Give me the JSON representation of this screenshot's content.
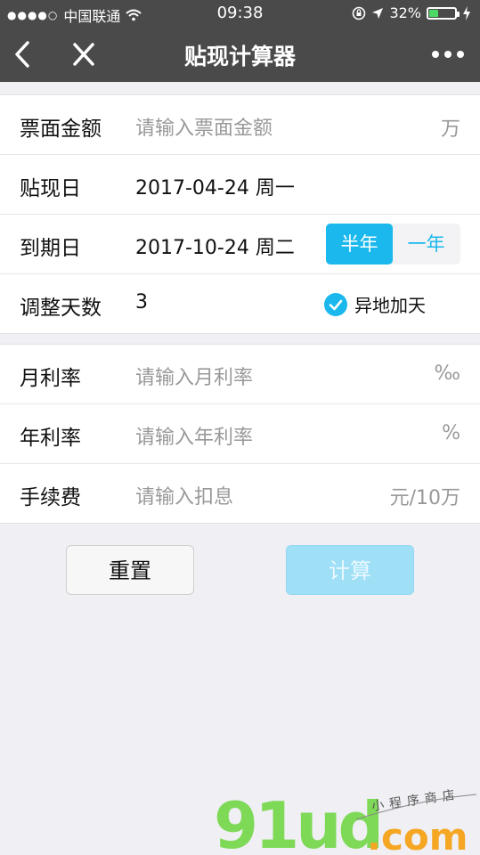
{
  "status_bar": {
    "carrier": "中国联通",
    "time": "09:38",
    "battery": "32%",
    "battery_level": 0.32
  },
  "nav": {
    "title": "贴现计算器",
    "back_icon": "chevron-left-icon",
    "close_icon": "close-icon",
    "more_icon": "more-icon"
  },
  "form1": {
    "face_amount": {
      "label": "票面金额",
      "placeholder": "请输入票面金额",
      "unit": "万"
    },
    "discount_date": {
      "label": "贴现日",
      "value": "2017-04-24 周一"
    },
    "due_date": {
      "label": "到期日",
      "value": "2017-10-24 周二",
      "term_options": [
        "半年",
        "一年"
      ],
      "selected_term": "半年"
    },
    "adjust_days": {
      "label": "调整天数",
      "value": "3",
      "checkbox_label": "异地加天",
      "checked": true
    }
  },
  "form2": {
    "monthly_rate": {
      "label": "月利率",
      "placeholder": "请输入月利率",
      "unit": "‰"
    },
    "annual_rate": {
      "label": "年利率",
      "placeholder": "请输入年利率",
      "unit": "%"
    },
    "fee": {
      "label": "手续费",
      "placeholder": "请输入扣息",
      "unit": "元/10万"
    }
  },
  "buttons": {
    "reset": "重置",
    "calculate": "计算"
  },
  "watermark": {
    "logo_text": "91ud",
    "domain_text": ".com",
    "tagline": "小程序商店"
  },
  "colors": {
    "accent": "#1ab8ec",
    "navbar": "#4a4a4a",
    "disabled_button": "#9fe0f7"
  }
}
